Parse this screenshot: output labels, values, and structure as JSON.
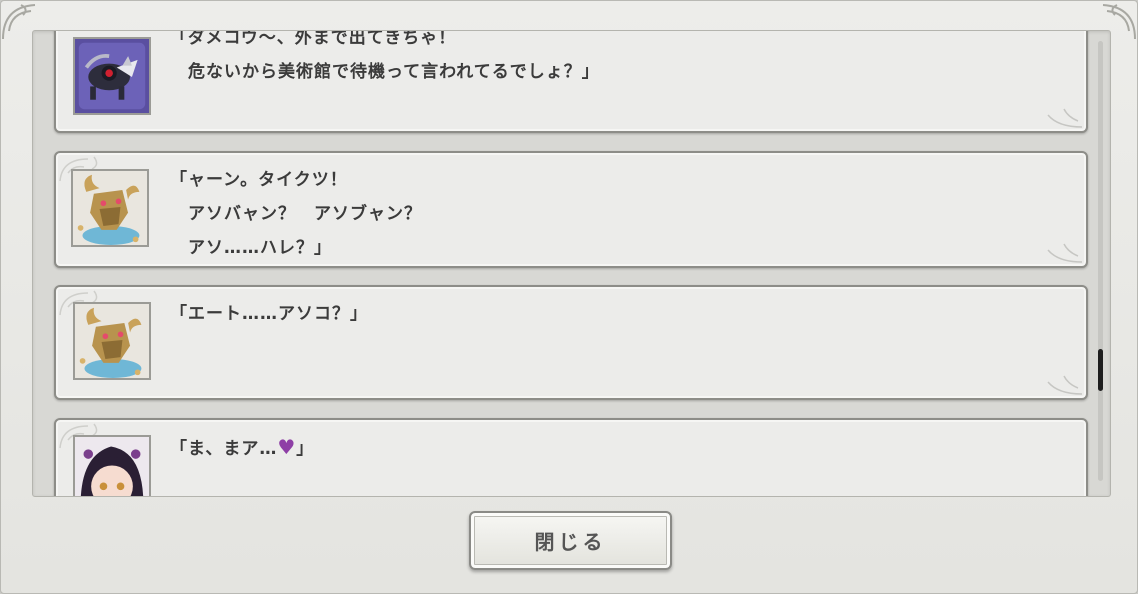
{
  "dialog_log": {
    "entries": [
      {
        "speaker_icon": "mechanical-wolf-portrait",
        "lines": "「ダメコウ〜、外まで出てきちゃ！\n　危ないから美術館で待機って言われてるでしょ？」"
      },
      {
        "speaker_icon": "golden-bull-portrait",
        "lines": "「ャーン。タイクツ！\n　アソバャン？　アソブャン？\n　アソ……ハレ？」"
      },
      {
        "speaker_icon": "golden-bull-portrait",
        "lines": "「エート……アソコ？」"
      },
      {
        "speaker_icon": "dark-haired-girl-portrait",
        "lines": "「ま、まア…",
        "lines_end": "」",
        "heart": "♥"
      }
    ]
  },
  "close_button": {
    "label": "閉じる"
  },
  "colors": {
    "heart": "#8e3fa6",
    "panel": "#ececea",
    "frame": "#e8e8e4"
  }
}
